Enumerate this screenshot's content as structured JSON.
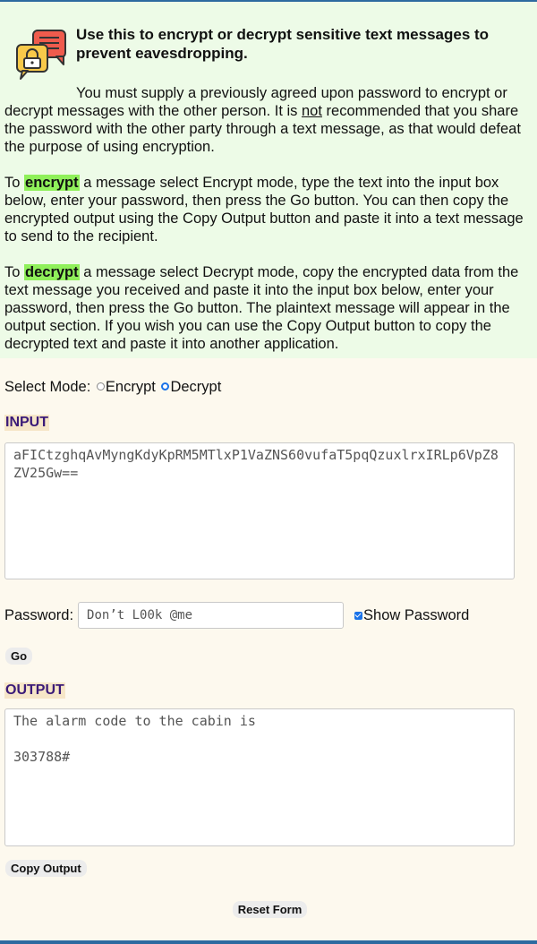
{
  "intro": {
    "title": "Use this to encrypt or decrypt sensitive text messages to prevent eavesdropping.",
    "p1_a": "You must supply a previously agreed upon password to encrypt or decrypt messages with the other person. It is ",
    "p1_not": "not",
    "p1_b": " recommended that you share the password with the other party through a text message, as that would defeat the purpose of using encryption.",
    "p2_a": "To ",
    "p2_kw": "encrypt",
    "p2_b": " a message select Encrypt mode, type the text into the input box below, enter your password, then press the Go button. You can then copy the encrypted output using the Copy Output button and paste it into a text message to send to the recipient.",
    "p3_a": "To ",
    "p3_kw": "decrypt",
    "p3_b": " a message select Decrypt mode, copy the encrypted data from the text message you received and paste it into the input box below, enter your password, then press the Go button. The plaintext message will appear in the output section. If you wish you can use the Copy Output button to copy the decrypted text and paste it into another application."
  },
  "mode": {
    "label": "Select Mode:",
    "options": [
      "Encrypt",
      "Decrypt"
    ],
    "selected": "Decrypt"
  },
  "input": {
    "label": "INPUT",
    "value": "aFICtzghqAvMyngKdyKpRM5MTlxP1VaZNS60vufaT5pqQzuxlrxIRLp6VpZ8ZV25Gw=="
  },
  "password": {
    "label": "Password:",
    "value": "Don’t L00k @me",
    "show_label": "Show Password",
    "show_checked": true
  },
  "buttons": {
    "go": "Go",
    "copy": "Copy Output",
    "reset": "Reset Form"
  },
  "output": {
    "label": "OUTPUT",
    "value": "The alarm code to the cabin is\n\n303788#"
  },
  "icons": {
    "logo": "encrypted-chat-icon"
  },
  "colors": {
    "highlight": "#8ff05a",
    "section_label": "#3a1a78",
    "radio_selected": "#1a73e8"
  }
}
